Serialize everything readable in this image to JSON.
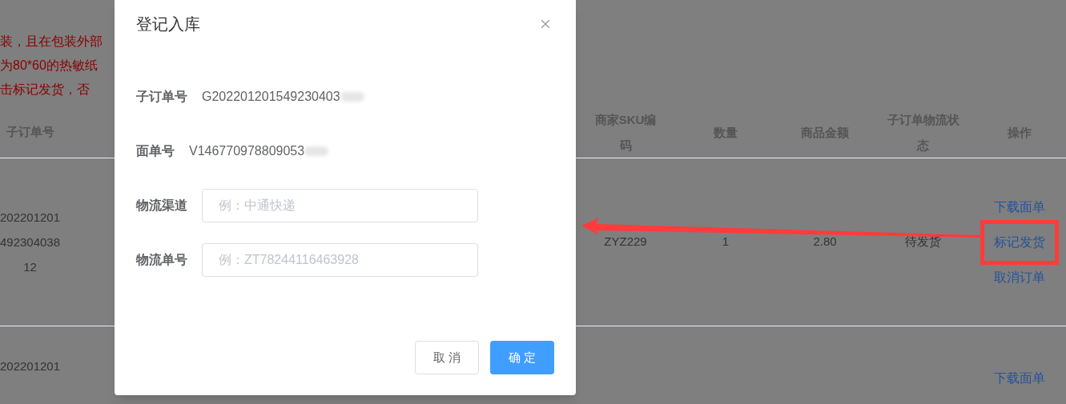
{
  "notice_lines": [
    "装，且在包装外部",
    "为80*60的热敏纸",
    "击标记发货，否"
  ],
  "table": {
    "columns": [
      "子订单号",
      "商家SKU编码",
      "数量",
      "商品金额",
      "子订单物流状态",
      "操作"
    ],
    "rows": [
      {
        "order_no": [
          "202201201",
          "492304038",
          "12"
        ],
        "sku": "ZYZ229",
        "quantity": "1",
        "amount": "2.80",
        "status": "待发货",
        "actions": [
          {
            "label": "下载面单",
            "highlighted": false
          },
          {
            "label": "标记发货",
            "highlighted": true
          },
          {
            "label": "取消订单",
            "highlighted": false
          }
        ]
      },
      {
        "order_no": [
          "202201201"
        ],
        "actions": [
          {
            "label": "下载面单",
            "highlighted": false
          }
        ]
      }
    ]
  },
  "dialog": {
    "title": "登记入库",
    "fields": [
      {
        "kind": "text",
        "label": "子订单号",
        "value": "G202201201549230403",
        "redacted": true
      },
      {
        "kind": "text",
        "label": "面单号",
        "value": "V146770978809053",
        "redacted": true
      },
      {
        "kind": "input",
        "label": "物流渠道",
        "placeholder": "例：中通快递"
      },
      {
        "kind": "input",
        "label": "物流单号",
        "placeholder": "例：ZT78244116463928"
      }
    ],
    "buttons": [
      {
        "label": "取 消",
        "kind": "secondary"
      },
      {
        "label": "确 定",
        "kind": "primary"
      }
    ]
  }
}
